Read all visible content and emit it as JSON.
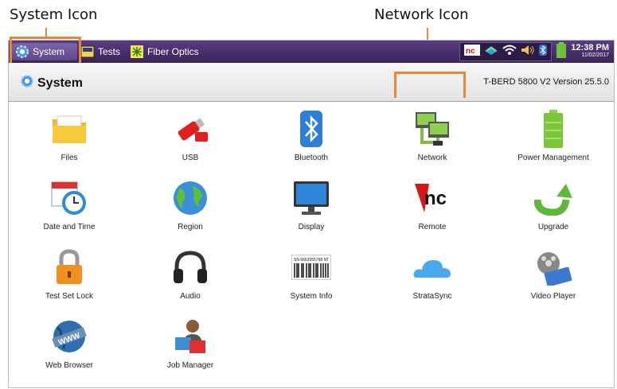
{
  "callouts": {
    "system": "System Icon",
    "network": "Network Icon"
  },
  "taskbar": {
    "system_label": "System",
    "tests_label": "Tests",
    "fiber_label": "Fiber Optics",
    "clock_time": "12:38 PM",
    "clock_date": "11/02/2017"
  },
  "header": {
    "title": "System",
    "version": "T-BERD 5800 V2 Version 25.5.0"
  },
  "apps": [
    {
      "label": "Files",
      "icon": "folder-icon"
    },
    {
      "label": "USB",
      "icon": "usb-icon"
    },
    {
      "label": "Bluetooth",
      "icon": "bluetooth-icon"
    },
    {
      "label": "Network",
      "icon": "network-icon"
    },
    {
      "label": "Power Management",
      "icon": "battery-icon"
    },
    {
      "label": "Date and Time",
      "icon": "calendar-clock-icon"
    },
    {
      "label": "Region",
      "icon": "globe-icon"
    },
    {
      "label": "Display",
      "icon": "monitor-icon"
    },
    {
      "label": "Remote",
      "icon": "remote-vnc-icon"
    },
    {
      "label": "Upgrade",
      "icon": "upgrade-arrow-icon"
    },
    {
      "label": "Test Set Lock",
      "icon": "lock-icon"
    },
    {
      "label": "Audio",
      "icon": "headphones-icon"
    },
    {
      "label": "System Info",
      "icon": "barcode-icon"
    },
    {
      "label": "StrataSync",
      "icon": "cloud-icon"
    },
    {
      "label": "Video Player",
      "icon": "film-reel-icon"
    },
    {
      "label": "Web Browser",
      "icon": "www-globe-icon"
    },
    {
      "label": "Job Manager",
      "icon": "job-manager-icon"
    }
  ],
  "barcode_text": "SN 6663555768 NT",
  "colors": {
    "taskbar": "#3a2358",
    "accent": "#e6883a"
  }
}
